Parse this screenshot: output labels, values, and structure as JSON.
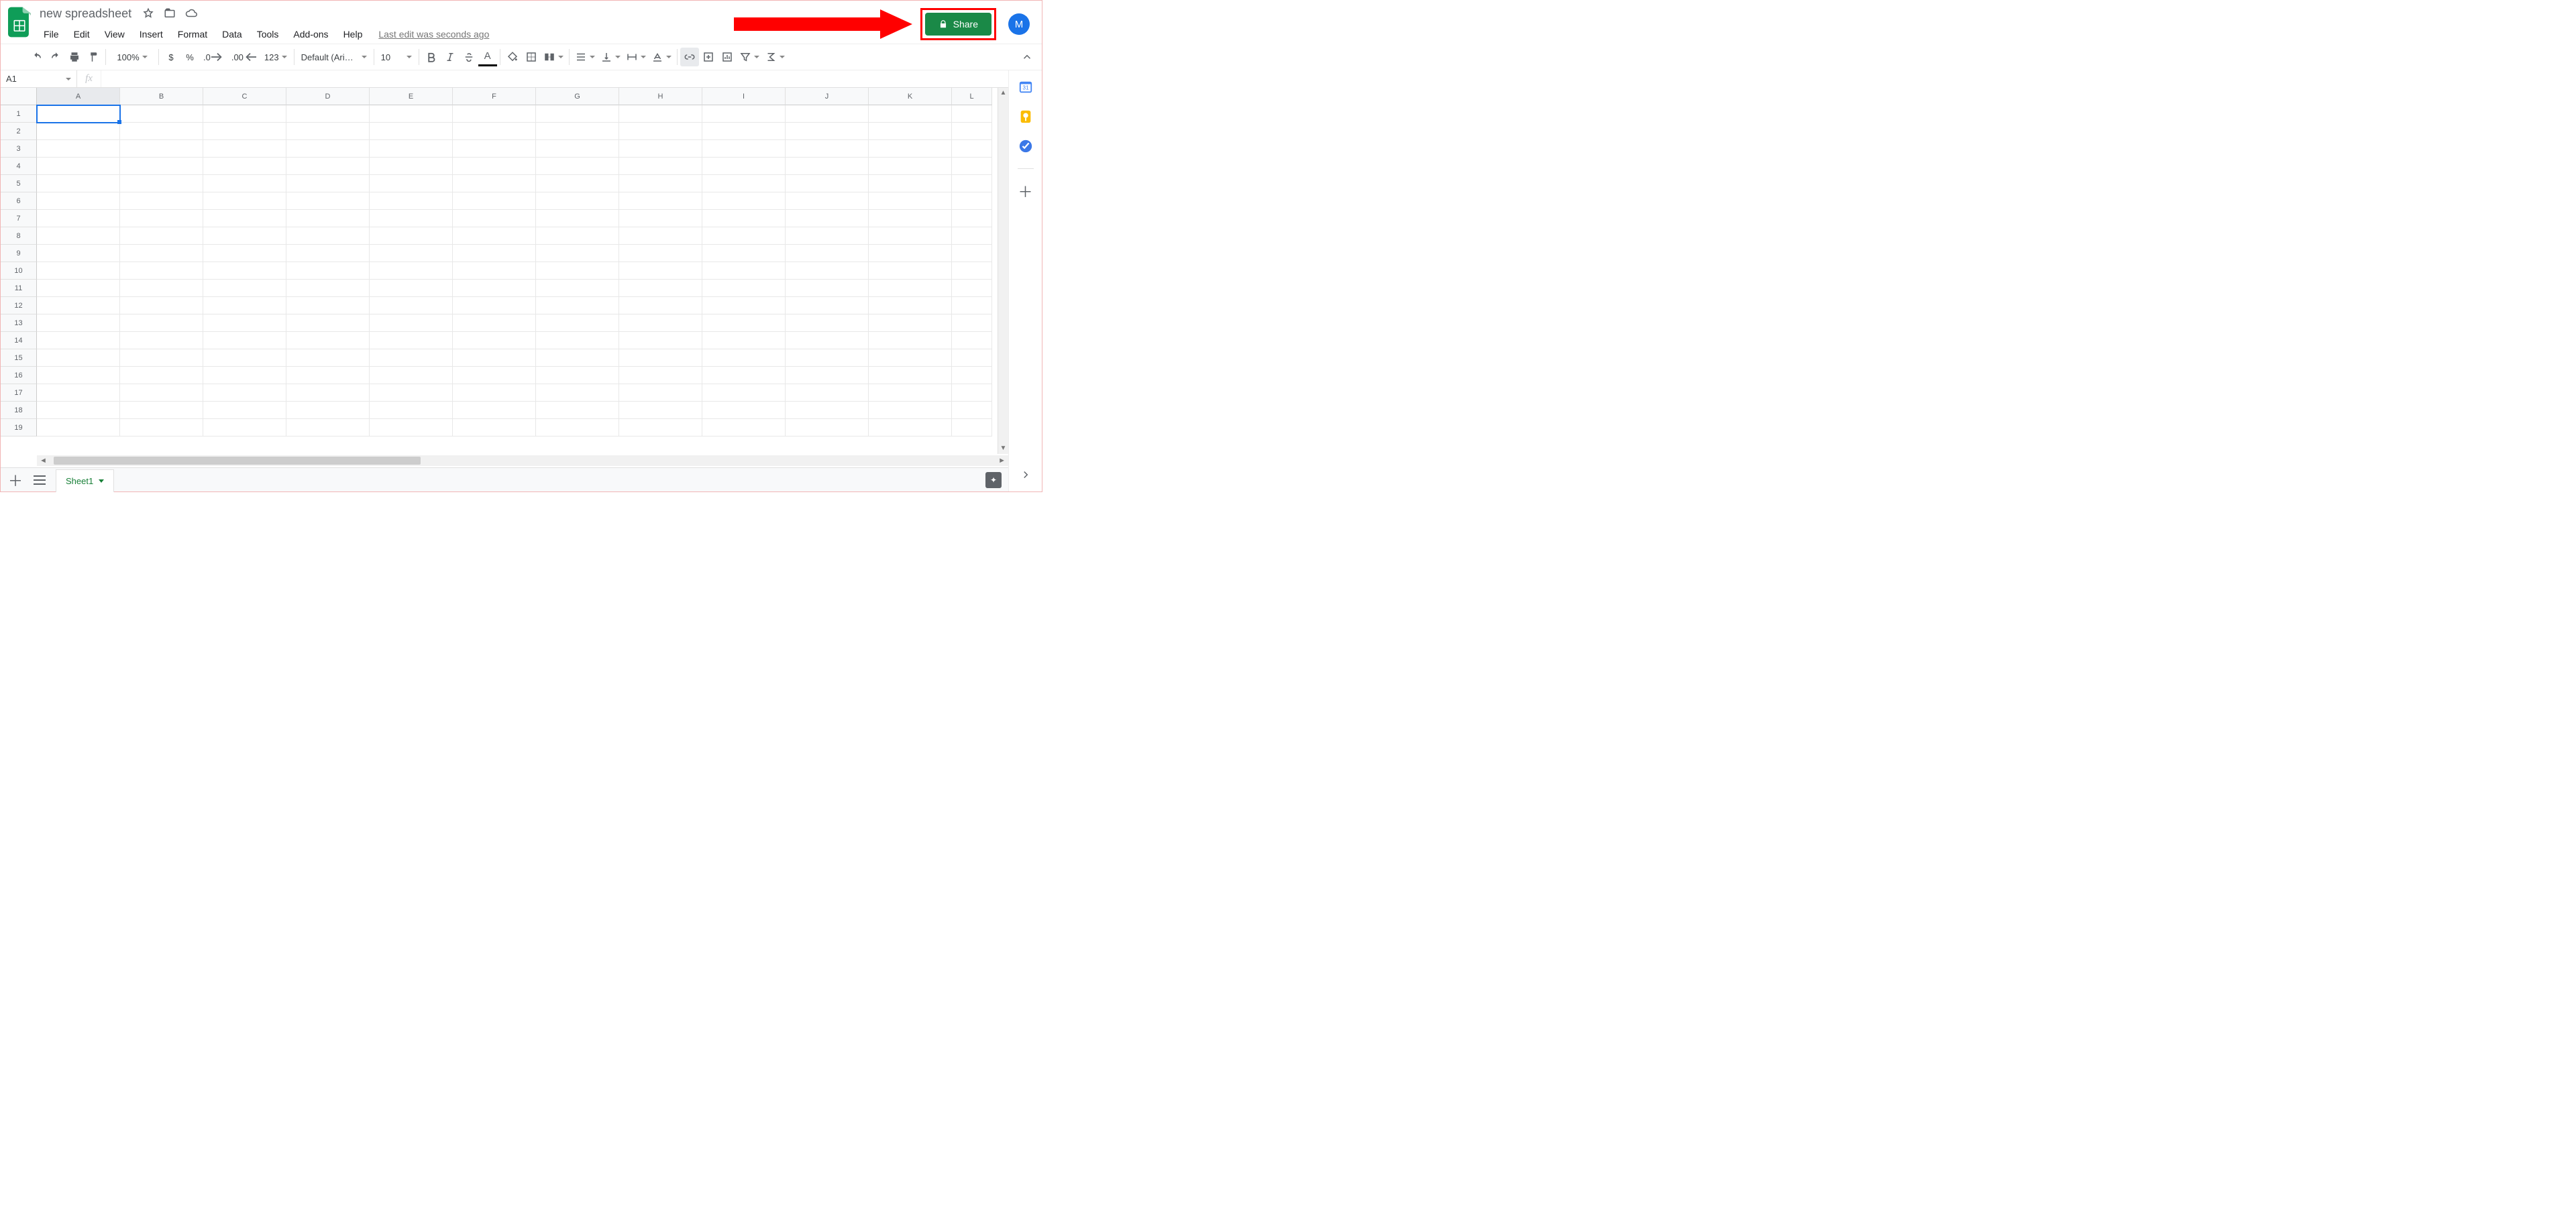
{
  "header": {
    "title": "new spreadsheet",
    "menus": [
      "File",
      "Edit",
      "View",
      "Insert",
      "Format",
      "Data",
      "Tools",
      "Add-ons",
      "Help"
    ],
    "last_edit": "Last edit was seconds ago",
    "share_label": "Share",
    "avatar_initial": "M"
  },
  "toolbar": {
    "zoom": "100%",
    "font": "Default (Ari…",
    "font_size": "10",
    "decrease_dec": ".0",
    "increase_dec": ".00",
    "more_formats": "123",
    "currency": "$",
    "percent": "%"
  },
  "namebox": {
    "value": "A1"
  },
  "columns": [
    "A",
    "B",
    "C",
    "D",
    "E",
    "F",
    "G",
    "H",
    "I",
    "J",
    "K",
    "L"
  ],
  "rows": [
    "1",
    "2",
    "3",
    "4",
    "5",
    "6",
    "7",
    "8",
    "9",
    "10",
    "11",
    "12",
    "13",
    "14",
    "15",
    "16",
    "17",
    "18",
    "19"
  ],
  "sheet_tab": "Sheet1",
  "sidepanel": {
    "calendar_day": "31"
  }
}
